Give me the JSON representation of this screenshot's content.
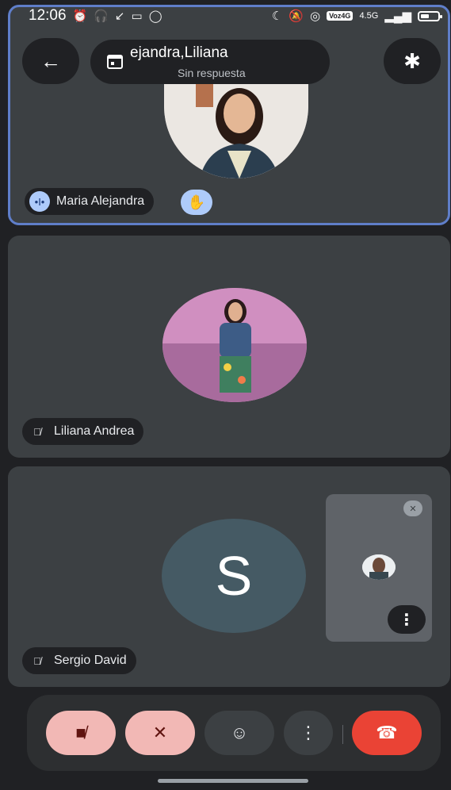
{
  "status_bar": {
    "time": "12:06",
    "left_icons": [
      "alarm-icon",
      "headset-icon",
      "battery-small-icon",
      "arrow-icon",
      "video-icon",
      "whatsapp-icon"
    ],
    "right_icons": [
      "moon-icon",
      "bell-off-icon",
      "hotspot-icon"
    ],
    "network_label": "Voz4G",
    "signal_label": "4.5G"
  },
  "header": {
    "title": "ejandra,Liliana",
    "subtitle": "Sin respuesta",
    "back_icon": "arrow-left-icon",
    "calendar_icon": "calendar-icon",
    "bluetooth_icon": "bluetooth-icon"
  },
  "participants": [
    {
      "name": "Maria Alejandra",
      "state": "speaking",
      "hand_raised": true
    },
    {
      "name": "Liliana Andrea",
      "state": "muted",
      "hand_raised": false
    },
    {
      "name": "Sergio David",
      "state": "muted",
      "hand_raised": false,
      "initial": "S"
    }
  ],
  "controls": {
    "camera": "camera-off-icon",
    "mic": "mic-off-icon",
    "reactions": "emoji-icon",
    "more": "more-vert-icon",
    "end_call": "end-call-icon"
  },
  "colors": {
    "background": "#202124",
    "tile": "#3c4043",
    "accent": "#aecbfa",
    "end_call": "#ea4335",
    "off_button": "#f2b8b5"
  }
}
